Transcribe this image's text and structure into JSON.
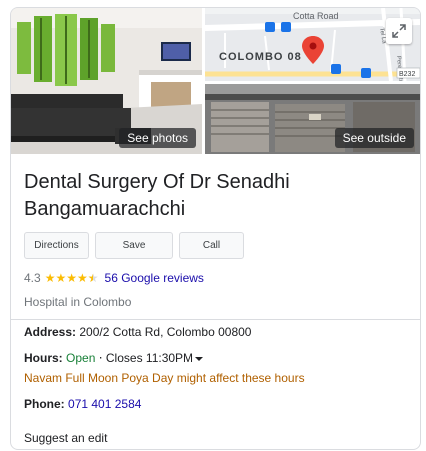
{
  "photos": {
    "main_label": "See photos",
    "outside_label": "See outside",
    "map": {
      "road_label": "Cotta Road",
      "area_label": "COLOMBO 08",
      "side_road_1": "Tel La",
      "side_road_2": "Perera Rd",
      "route_badge": "B232"
    }
  },
  "place": {
    "title": "Dental Surgery Of Dr Senadhi Bangamuarachchi",
    "rating": "4.3",
    "stars": 4.3,
    "reviews_link": "56 Google reviews",
    "category": "Hospital in Colombo"
  },
  "actions": {
    "directions": "Directions",
    "save": "Save",
    "call": "Call"
  },
  "details": {
    "address_label": "Address:",
    "address_value": "200/2 Cotta Rd, Colombo 00800",
    "hours_label": "Hours:",
    "hours_open": "Open",
    "hours_sep": "⋅",
    "hours_close": "Closes 11:30PM",
    "hours_note": "Navam Full Moon Poya Day might affect these hours",
    "phone_label": "Phone:",
    "phone_value": "071 401 2584",
    "suggest_edit": "Suggest an edit"
  },
  "colors": {
    "link": "#1a0dab",
    "open": "#188038",
    "warning": "#b06000",
    "star": "#fbbc04",
    "map_pin": "#ea4335"
  }
}
